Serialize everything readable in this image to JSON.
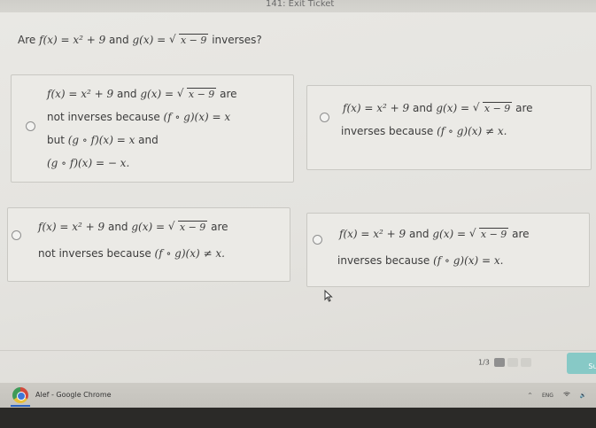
{
  "header": {
    "exit_label": "141: Exit Ticket"
  },
  "question": {
    "pre": "Are ",
    "f_def": "f(x) = x² + 9",
    "mid": " and ",
    "g_lhs": "g(x) = ",
    "g_rad": "x − 9",
    "post": " inverses?"
  },
  "choices": [
    {
      "line1": {
        "f_def": "f(x) = x² + 9",
        "and": " and ",
        "g_lhs": "g(x) = ",
        "g_rad": "x − 9",
        "tail": " are"
      },
      "line2": {
        "text": "not inverses because ",
        "expr": "(f ∘ g)(x) = x"
      },
      "line3": {
        "text": "but ",
        "expr": "(g ∘ f)(x) = x",
        "tail": " and"
      },
      "line4": {
        "expr": "(g ∘ f)(x) = − x."
      }
    },
    {
      "line1": {
        "f_def": "f(x) = x² + 9",
        "and": " and ",
        "g_lhs": "g(x) = ",
        "g_rad": "x − 9",
        "tail": " are"
      },
      "line2": {
        "text": "inverses because ",
        "expr": "(f ∘ g)(x) ≠ x."
      }
    },
    {
      "line1": {
        "f_def": "f(x) = x² + 9",
        "and": " and ",
        "g_lhs": "g(x) = ",
        "g_rad": "x − 9",
        "tail": " are"
      },
      "line2": {
        "text": "not inverses because ",
        "expr": "(f ∘ g)(x) ≠ x."
      }
    },
    {
      "line1": {
        "f_def": "f(x) = x² + 9",
        "and": " and ",
        "g_lhs": "g(x) = ",
        "g_rad": "x − 9",
        "tail": " are"
      },
      "line2": {
        "text": "inverses because ",
        "expr": "(f ∘ g)(x) = x."
      }
    }
  ],
  "pager": {
    "label": "1/3"
  },
  "submit": {
    "label": "Sub"
  },
  "taskbar": {
    "app_title": "Alef - Google Chrome",
    "tray_caret": "^",
    "tray_lang": "ENG",
    "tray_wifi": "wifi",
    "tray_sound": "🔊"
  }
}
